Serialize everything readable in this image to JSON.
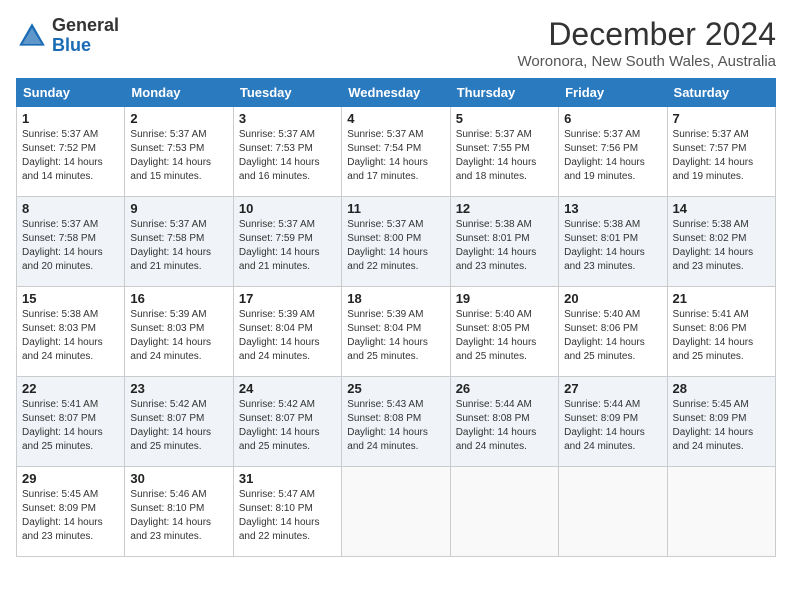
{
  "logo": {
    "general": "General",
    "blue": "Blue"
  },
  "title": "December 2024",
  "subtitle": "Woronora, New South Wales, Australia",
  "days_of_week": [
    "Sunday",
    "Monday",
    "Tuesday",
    "Wednesday",
    "Thursday",
    "Friday",
    "Saturday"
  ],
  "weeks": [
    [
      {
        "day": "1",
        "info": "Sunrise: 5:37 AM\nSunset: 7:52 PM\nDaylight: 14 hours\nand 14 minutes."
      },
      {
        "day": "2",
        "info": "Sunrise: 5:37 AM\nSunset: 7:53 PM\nDaylight: 14 hours\nand 15 minutes."
      },
      {
        "day": "3",
        "info": "Sunrise: 5:37 AM\nSunset: 7:53 PM\nDaylight: 14 hours\nand 16 minutes."
      },
      {
        "day": "4",
        "info": "Sunrise: 5:37 AM\nSunset: 7:54 PM\nDaylight: 14 hours\nand 17 minutes."
      },
      {
        "day": "5",
        "info": "Sunrise: 5:37 AM\nSunset: 7:55 PM\nDaylight: 14 hours\nand 18 minutes."
      },
      {
        "day": "6",
        "info": "Sunrise: 5:37 AM\nSunset: 7:56 PM\nDaylight: 14 hours\nand 19 minutes."
      },
      {
        "day": "7",
        "info": "Sunrise: 5:37 AM\nSunset: 7:57 PM\nDaylight: 14 hours\nand 19 minutes."
      }
    ],
    [
      {
        "day": "8",
        "info": "Sunrise: 5:37 AM\nSunset: 7:58 PM\nDaylight: 14 hours\nand 20 minutes."
      },
      {
        "day": "9",
        "info": "Sunrise: 5:37 AM\nSunset: 7:58 PM\nDaylight: 14 hours\nand 21 minutes."
      },
      {
        "day": "10",
        "info": "Sunrise: 5:37 AM\nSunset: 7:59 PM\nDaylight: 14 hours\nand 21 minutes."
      },
      {
        "day": "11",
        "info": "Sunrise: 5:37 AM\nSunset: 8:00 PM\nDaylight: 14 hours\nand 22 minutes."
      },
      {
        "day": "12",
        "info": "Sunrise: 5:38 AM\nSunset: 8:01 PM\nDaylight: 14 hours\nand 23 minutes."
      },
      {
        "day": "13",
        "info": "Sunrise: 5:38 AM\nSunset: 8:01 PM\nDaylight: 14 hours\nand 23 minutes."
      },
      {
        "day": "14",
        "info": "Sunrise: 5:38 AM\nSunset: 8:02 PM\nDaylight: 14 hours\nand 23 minutes."
      }
    ],
    [
      {
        "day": "15",
        "info": "Sunrise: 5:38 AM\nSunset: 8:03 PM\nDaylight: 14 hours\nand 24 minutes."
      },
      {
        "day": "16",
        "info": "Sunrise: 5:39 AM\nSunset: 8:03 PM\nDaylight: 14 hours\nand 24 minutes."
      },
      {
        "day": "17",
        "info": "Sunrise: 5:39 AM\nSunset: 8:04 PM\nDaylight: 14 hours\nand 24 minutes."
      },
      {
        "day": "18",
        "info": "Sunrise: 5:39 AM\nSunset: 8:04 PM\nDaylight: 14 hours\nand 25 minutes."
      },
      {
        "day": "19",
        "info": "Sunrise: 5:40 AM\nSunset: 8:05 PM\nDaylight: 14 hours\nand 25 minutes."
      },
      {
        "day": "20",
        "info": "Sunrise: 5:40 AM\nSunset: 8:06 PM\nDaylight: 14 hours\nand 25 minutes."
      },
      {
        "day": "21",
        "info": "Sunrise: 5:41 AM\nSunset: 8:06 PM\nDaylight: 14 hours\nand 25 minutes."
      }
    ],
    [
      {
        "day": "22",
        "info": "Sunrise: 5:41 AM\nSunset: 8:07 PM\nDaylight: 14 hours\nand 25 minutes."
      },
      {
        "day": "23",
        "info": "Sunrise: 5:42 AM\nSunset: 8:07 PM\nDaylight: 14 hours\nand 25 minutes."
      },
      {
        "day": "24",
        "info": "Sunrise: 5:42 AM\nSunset: 8:07 PM\nDaylight: 14 hours\nand 25 minutes."
      },
      {
        "day": "25",
        "info": "Sunrise: 5:43 AM\nSunset: 8:08 PM\nDaylight: 14 hours\nand 24 minutes."
      },
      {
        "day": "26",
        "info": "Sunrise: 5:44 AM\nSunset: 8:08 PM\nDaylight: 14 hours\nand 24 minutes."
      },
      {
        "day": "27",
        "info": "Sunrise: 5:44 AM\nSunset: 8:09 PM\nDaylight: 14 hours\nand 24 minutes."
      },
      {
        "day": "28",
        "info": "Sunrise: 5:45 AM\nSunset: 8:09 PM\nDaylight: 14 hours\nand 24 minutes."
      }
    ],
    [
      {
        "day": "29",
        "info": "Sunrise: 5:45 AM\nSunset: 8:09 PM\nDaylight: 14 hours\nand 23 minutes."
      },
      {
        "day": "30",
        "info": "Sunrise: 5:46 AM\nSunset: 8:10 PM\nDaylight: 14 hours\nand 23 minutes."
      },
      {
        "day": "31",
        "info": "Sunrise: 5:47 AM\nSunset: 8:10 PM\nDaylight: 14 hours\nand 22 minutes."
      },
      {
        "day": "",
        "info": ""
      },
      {
        "day": "",
        "info": ""
      },
      {
        "day": "",
        "info": ""
      },
      {
        "day": "",
        "info": ""
      }
    ]
  ]
}
